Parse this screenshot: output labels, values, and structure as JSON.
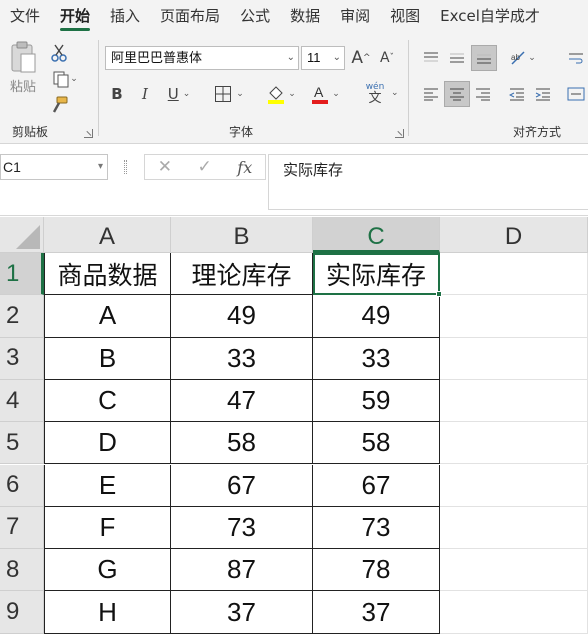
{
  "ribbon_tabs": [
    "文件",
    "开始",
    "插入",
    "页面布局",
    "公式",
    "数据",
    "审阅",
    "视图",
    "Excel自学成才"
  ],
  "active_tab": "开始",
  "clipboard": {
    "paste_label": "粘贴",
    "group_title": "剪贴板"
  },
  "font": {
    "font_name": "阿里巴巴普惠体",
    "font_size": "11",
    "grow_glyph": "A",
    "shrink_glyph": "A",
    "bold_glyph": "B",
    "italic_glyph": "I",
    "underline_glyph": "U",
    "phonetic_glyph": "wén",
    "phonetic_sub": "文",
    "highlight_color": "#ffff00",
    "font_color": "#e31c1c",
    "group_title": "字体"
  },
  "alignment": {
    "group_title": "对齐方式"
  },
  "formula_bar": {
    "name_box": "C1",
    "cancel_glyph": "✕",
    "enter_glyph": "✓",
    "fx_glyph": "fx",
    "content": "实际库存"
  },
  "grid": {
    "columns": [
      "A",
      "B",
      "C",
      "D"
    ],
    "selected_column": "C",
    "selected_row": "1",
    "rows": [
      {
        "num": "1",
        "cells": [
          "商品数据",
          "理论库存",
          "实际库存"
        ]
      },
      {
        "num": "2",
        "cells": [
          "A",
          "49",
          "49"
        ]
      },
      {
        "num": "3",
        "cells": [
          "B",
          "33",
          "33"
        ]
      },
      {
        "num": "4",
        "cells": [
          "C",
          "47",
          "59"
        ]
      },
      {
        "num": "5",
        "cells": [
          "D",
          "58",
          "58"
        ]
      },
      {
        "num": "6",
        "cells": [
          "E",
          "67",
          "67"
        ]
      },
      {
        "num": "7",
        "cells": [
          "F",
          "73",
          "73"
        ]
      },
      {
        "num": "8",
        "cells": [
          "G",
          "87",
          "78"
        ]
      },
      {
        "num": "9",
        "cells": [
          "H",
          "37",
          "37"
        ]
      }
    ]
  },
  "colors": {
    "accent": "#1e7145",
    "ribbon_bg": "#f3f3f3",
    "header_bg": "#e6e6e6"
  }
}
